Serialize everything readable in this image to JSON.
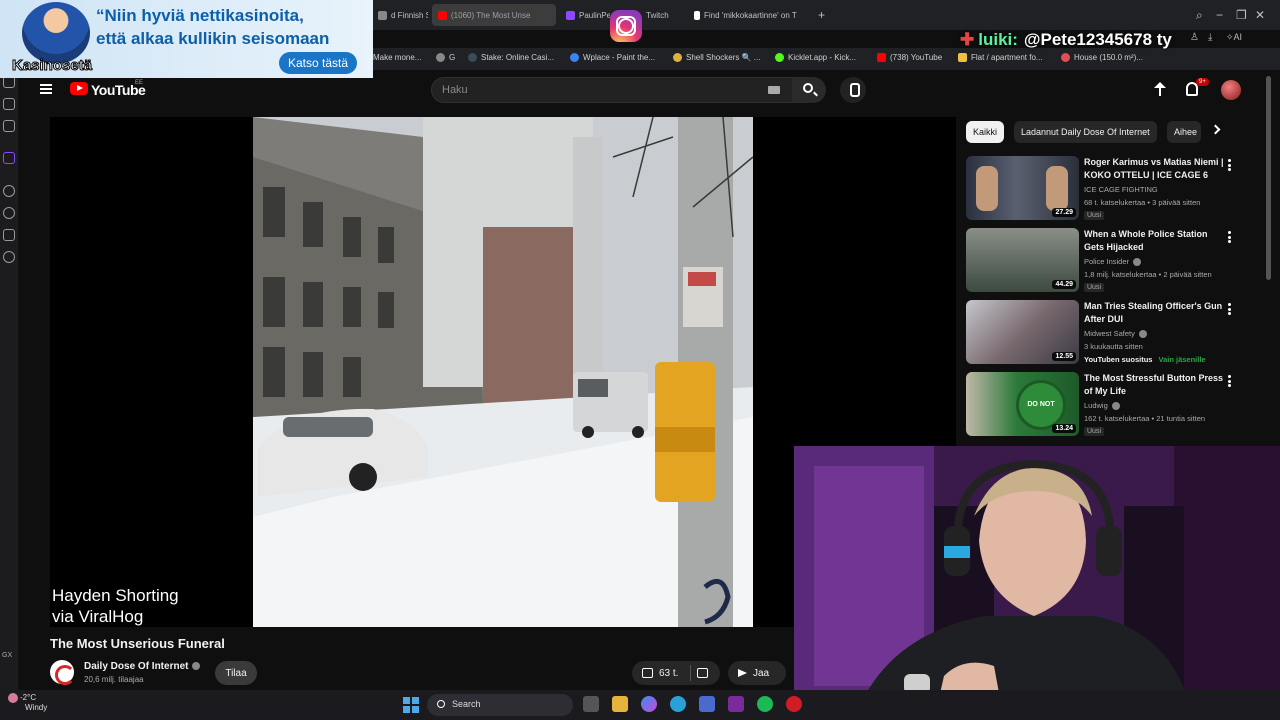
{
  "browser": {
    "tabs": [
      {
        "label": "d Finnish Str",
        "color": "#888888"
      },
      {
        "label": "(1060) The Most Unse",
        "color": "#ff0000",
        "active": true
      },
      {
        "label": "PaulinPe",
        "color": "#9146ff"
      },
      {
        "label": "Twitch",
        "color": "#9146ff"
      },
      {
        "label": "Find 'mikkokaartinne' on T",
        "color": "#ffffff"
      }
    ],
    "bookmarks": [
      {
        "label": "Make mone...",
        "color": "#888888"
      },
      {
        "label": "G",
        "color": "#888888"
      },
      {
        "label": "Stake: Online Casi...",
        "color": "#1a2c38"
      },
      {
        "label": "Wplace - Paint the...",
        "color": "#3b82f6"
      },
      {
        "label": "Shell Shockers 🔍 ...",
        "color": "#e0b040"
      },
      {
        "label": "Kicklet.app - Kick...",
        "color": "#53fc18"
      },
      {
        "label": "(738) YouTube",
        "color": "#ff0000"
      },
      {
        "label": "Flat / apartment fo...",
        "color": "#f0c040"
      },
      {
        "label": "House (150.0 m²)...",
        "color": "#e05050"
      }
    ]
  },
  "youtube": {
    "logo_text": "YouTube",
    "country_code": "EE",
    "search_placeholder": "Haku",
    "notif_badge": "9+"
  },
  "player": {
    "watermark_line1": "Hayden Shorting",
    "watermark_line2": "via ViralHog"
  },
  "video": {
    "title": "The Most Unserious Funeral",
    "channel": "Daily Dose Of Internet",
    "subscribers": "20,6 milj. tilaajaa",
    "subscribe_label": "Tilaa",
    "likes": "63 t.",
    "share_label": "Jaa"
  },
  "chips": [
    {
      "label": "Kaikki",
      "selected": true
    },
    {
      "label": "Ladannut Daily Dose Of Internet",
      "selected": false
    },
    {
      "label": "Aihee",
      "selected": false
    }
  ],
  "recommendations": [
    {
      "title": "Roger Karimus vs Matias Niemi | KOKO OTTELU | ICE CAGE 6",
      "channel": "ICE CAGE FIGHTING",
      "meta": "68 t. katselukertaa • 3 päivää sitten",
      "badge": "Uusi",
      "duration": "27.29",
      "verified": false,
      "member": ""
    },
    {
      "title": "When a Whole Police Station Gets Hijacked",
      "channel": "Police Insider",
      "meta": "1,8 milj. katselukertaa • 2 päivää sitten",
      "badge": "Uusi",
      "duration": "44.29",
      "verified": true,
      "member": ""
    },
    {
      "title": "Man Tries Stealing Officer's Gun After DUI",
      "channel": "Midwest Safety",
      "meta": "3 kuukautta sitten",
      "badge": "",
      "duration": "12.55",
      "verified": true,
      "member": "Vain jäsenille",
      "extra": "YouTuben suositus"
    },
    {
      "title": "The Most Stressful Button Press of My Life",
      "channel": "Ludwig",
      "meta": "162 t. katselukertaa • 21 tuntia sitten",
      "badge": "Uusi",
      "duration": "13.24",
      "verified": true,
      "member": "",
      "thumb_text": "DO NOT PRESS"
    }
  ],
  "ad": {
    "line1": "“Niin hyviä nettikasinoita,",
    "line2": "että alkaa kullikin seisomaan",
    "brand": "Kasinosetä",
    "cta": "Katso tästä"
  },
  "overlay": {
    "shoutout_label": "luiki:",
    "shoutout_text": "@Pete12345678 ty"
  },
  "taskbar": {
    "temperature": "-2°C",
    "weather": "Windy",
    "search_label": "Search"
  },
  "sidebar_label": "GX"
}
